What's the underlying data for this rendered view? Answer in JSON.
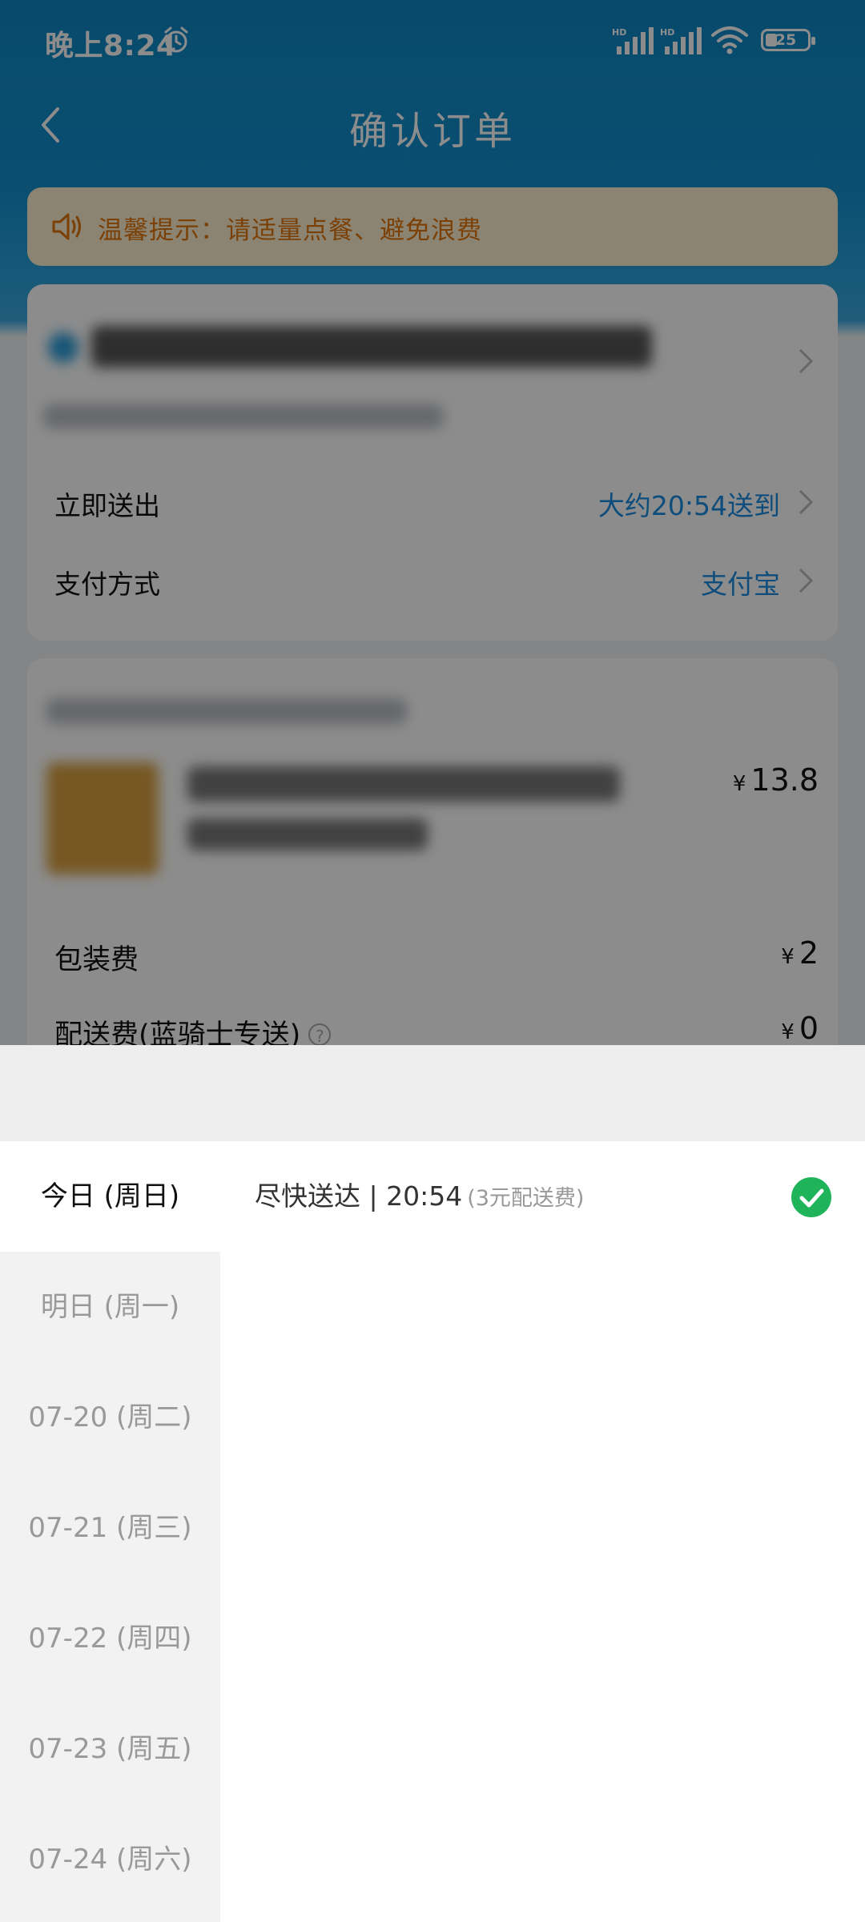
{
  "status_bar": {
    "time": "晚上8:24",
    "signal_label": "HD",
    "battery": "25"
  },
  "nav": {
    "title": "确认订单"
  },
  "tip": {
    "text": "温馨提示：请适量点餐、避免浪费"
  },
  "order_info": {
    "delivery_label": "立即送出",
    "delivery_value": "大约20:54送到",
    "payment_label": "支付方式",
    "payment_value": "支付宝"
  },
  "items": {
    "item_price_currency": "¥",
    "item_price": "13.8",
    "packing_label": "包装费",
    "packing_currency": "¥",
    "packing_value": "2",
    "delivery_fee_label": "配送费(蓝骑士专送)",
    "delivery_fee_currency": "¥",
    "delivery_fee_value": "0"
  },
  "time_picker": {
    "days": [
      {
        "label": "今日 (周日)",
        "selected": true
      },
      {
        "label": "明日 (周一)",
        "selected": false
      },
      {
        "label": "07-20 (周二)",
        "selected": false
      },
      {
        "label": "07-21 (周三)",
        "selected": false
      },
      {
        "label": "07-22 (周四)",
        "selected": false
      },
      {
        "label": "07-23 (周五)",
        "selected": false
      },
      {
        "label": "07-24 (周六)",
        "selected": false
      }
    ],
    "slot": {
      "label": "尽快送达 | 20:54",
      "fee": "(3元配送费)",
      "selected": true
    }
  },
  "colors": {
    "accent_blue": "#1a8de0",
    "check_green": "#1fb35a",
    "tip_orange": "#e0750a"
  }
}
